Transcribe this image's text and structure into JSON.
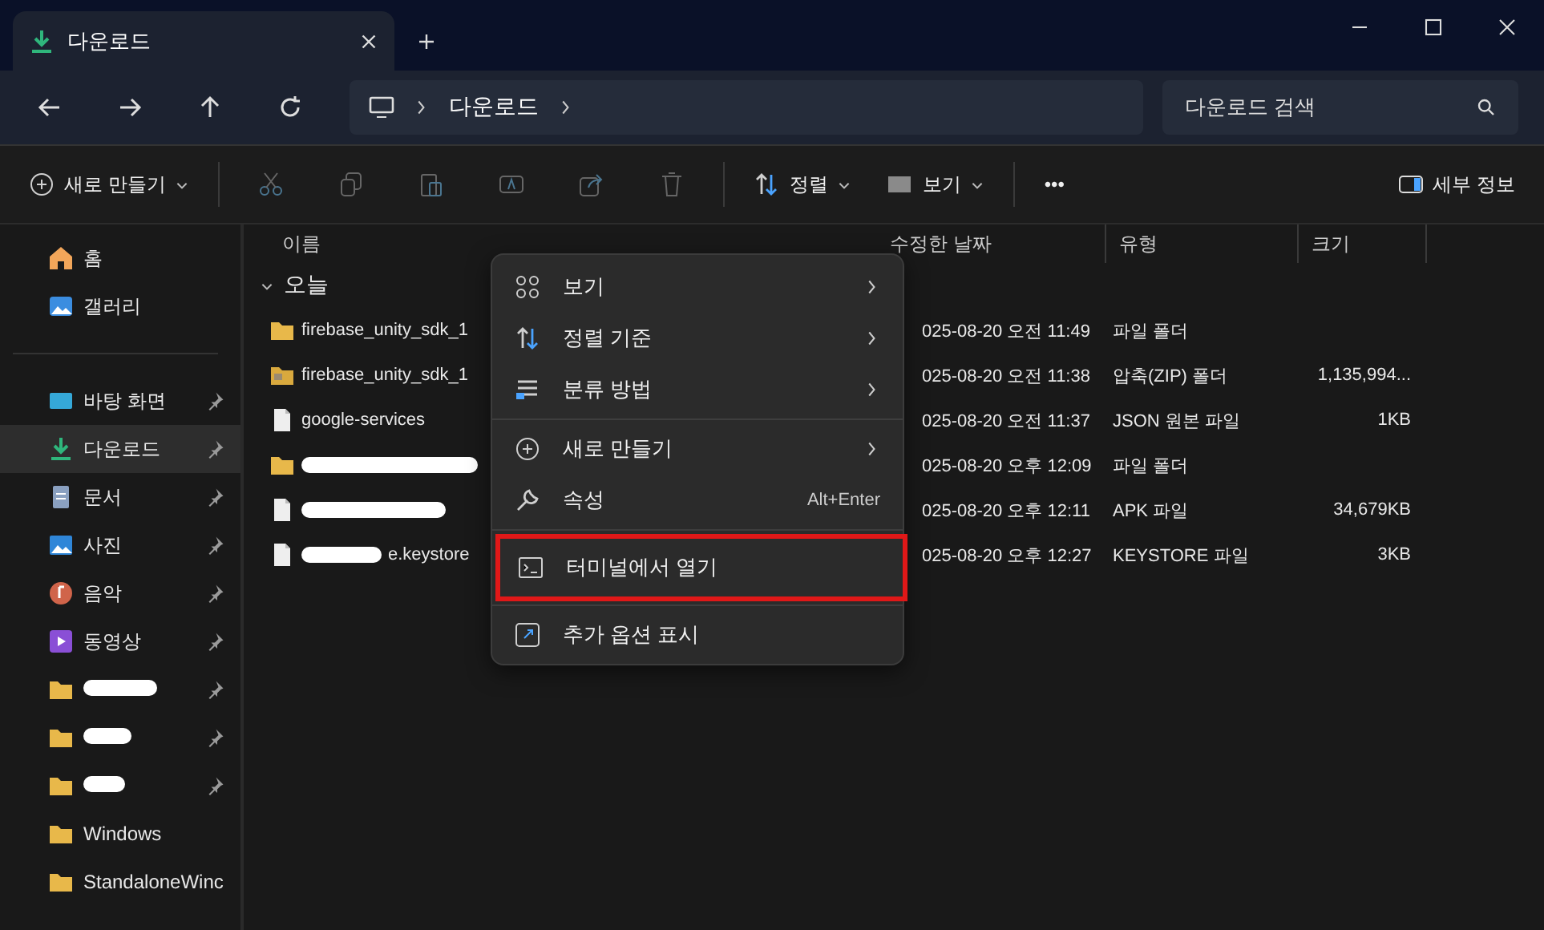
{
  "window": {
    "tab_title": "다운로드"
  },
  "address": {
    "crumbs": [
      "다운로드"
    ],
    "search_placeholder": "다운로드 검색"
  },
  "toolbar": {
    "new_label": "새로 만들기",
    "sort_label": "정렬",
    "view_label": "보기",
    "more": "•••",
    "details_label": "세부 정보"
  },
  "sidebar": {
    "items": [
      {
        "kind": "home",
        "label": "홈",
        "pinned": false,
        "selected": false,
        "redacted": false
      },
      {
        "kind": "gallery",
        "label": "갤러리",
        "pinned": false,
        "selected": false,
        "redacted": false
      },
      {
        "kind": "divider"
      },
      {
        "kind": "desktop",
        "label": "바탕 화면",
        "pinned": true,
        "selected": false,
        "redacted": false
      },
      {
        "kind": "download",
        "label": "다운로드",
        "pinned": true,
        "selected": true,
        "redacted": false
      },
      {
        "kind": "docs",
        "label": "문서",
        "pinned": true,
        "selected": false,
        "redacted": false
      },
      {
        "kind": "pictures",
        "label": "사진",
        "pinned": true,
        "selected": false,
        "redacted": false
      },
      {
        "kind": "music",
        "label": "음악",
        "pinned": true,
        "selected": false,
        "redacted": false
      },
      {
        "kind": "video",
        "label": "동영상",
        "pinned": true,
        "selected": false,
        "redacted": false
      },
      {
        "kind": "folder",
        "pinned": true,
        "selected": false,
        "redacted": true
      },
      {
        "kind": "folder",
        "pinned": true,
        "selected": false,
        "redacted": true
      },
      {
        "kind": "folder",
        "pinned": true,
        "selected": false,
        "redacted": true
      },
      {
        "kind": "folder",
        "label": "Windows",
        "pinned": false,
        "selected": false,
        "redacted": false
      },
      {
        "kind": "folder",
        "label": "StandaloneWinc",
        "pinned": false,
        "selected": false,
        "redacted": false
      }
    ]
  },
  "table": {
    "columns": [
      "이름",
      "수정한 날짜",
      "유형",
      "크기"
    ],
    "group": {
      "label": "오늘",
      "expanded": true
    },
    "rows": [
      {
        "kind": "folder",
        "name": "firebase_unity_sdk_1",
        "redacted": false,
        "date": "025-08-20 오전 11:49",
        "type": "파일 폴더"
      },
      {
        "kind": "zip",
        "name": "firebase_unity_sdk_1",
        "redacted": false,
        "date": "025-08-20 오전 11:38",
        "type": "압축(ZIP) 폴더",
        "size": "1,135,994..."
      },
      {
        "kind": "file",
        "name": "google-services",
        "redacted": false,
        "date": "025-08-20 오전 11:37",
        "type": "JSON 원본 파일",
        "size": "1KB"
      },
      {
        "kind": "folder",
        "redacted": true,
        "date": "025-08-20 오후 12:09",
        "type": "파일 폴더"
      },
      {
        "kind": "file",
        "redacted": true,
        "date": "025-08-20 오후 12:11",
        "type": "APK 파일",
        "size": "34,679KB"
      },
      {
        "kind": "file",
        "name": "e.keystore",
        "redacted": true,
        "date": "025-08-20 오후 12:27",
        "type": "KEYSTORE 파일",
        "size": "3KB"
      }
    ]
  },
  "context_menu": {
    "items": [
      {
        "kind": "item",
        "label": "보기",
        "submenu": true,
        "highlighted": false
      },
      {
        "kind": "item",
        "label": "정렬 기준",
        "submenu": true,
        "highlighted": false
      },
      {
        "kind": "item",
        "label": "분류 방법",
        "submenu": true,
        "highlighted": false
      },
      {
        "kind": "separator"
      },
      {
        "kind": "item",
        "label": "새로 만들기",
        "submenu": true,
        "highlighted": false
      },
      {
        "kind": "item",
        "label": "속성",
        "shortcut": "Alt+Enter",
        "submenu": false,
        "highlighted": false
      },
      {
        "kind": "separator"
      },
      {
        "kind": "item",
        "label": "터미널에서 열기",
        "submenu": false,
        "highlighted": true
      },
      {
        "kind": "separator"
      },
      {
        "kind": "item",
        "label": "추가 옵션 표시",
        "submenu": false,
        "highlighted": false
      }
    ]
  }
}
